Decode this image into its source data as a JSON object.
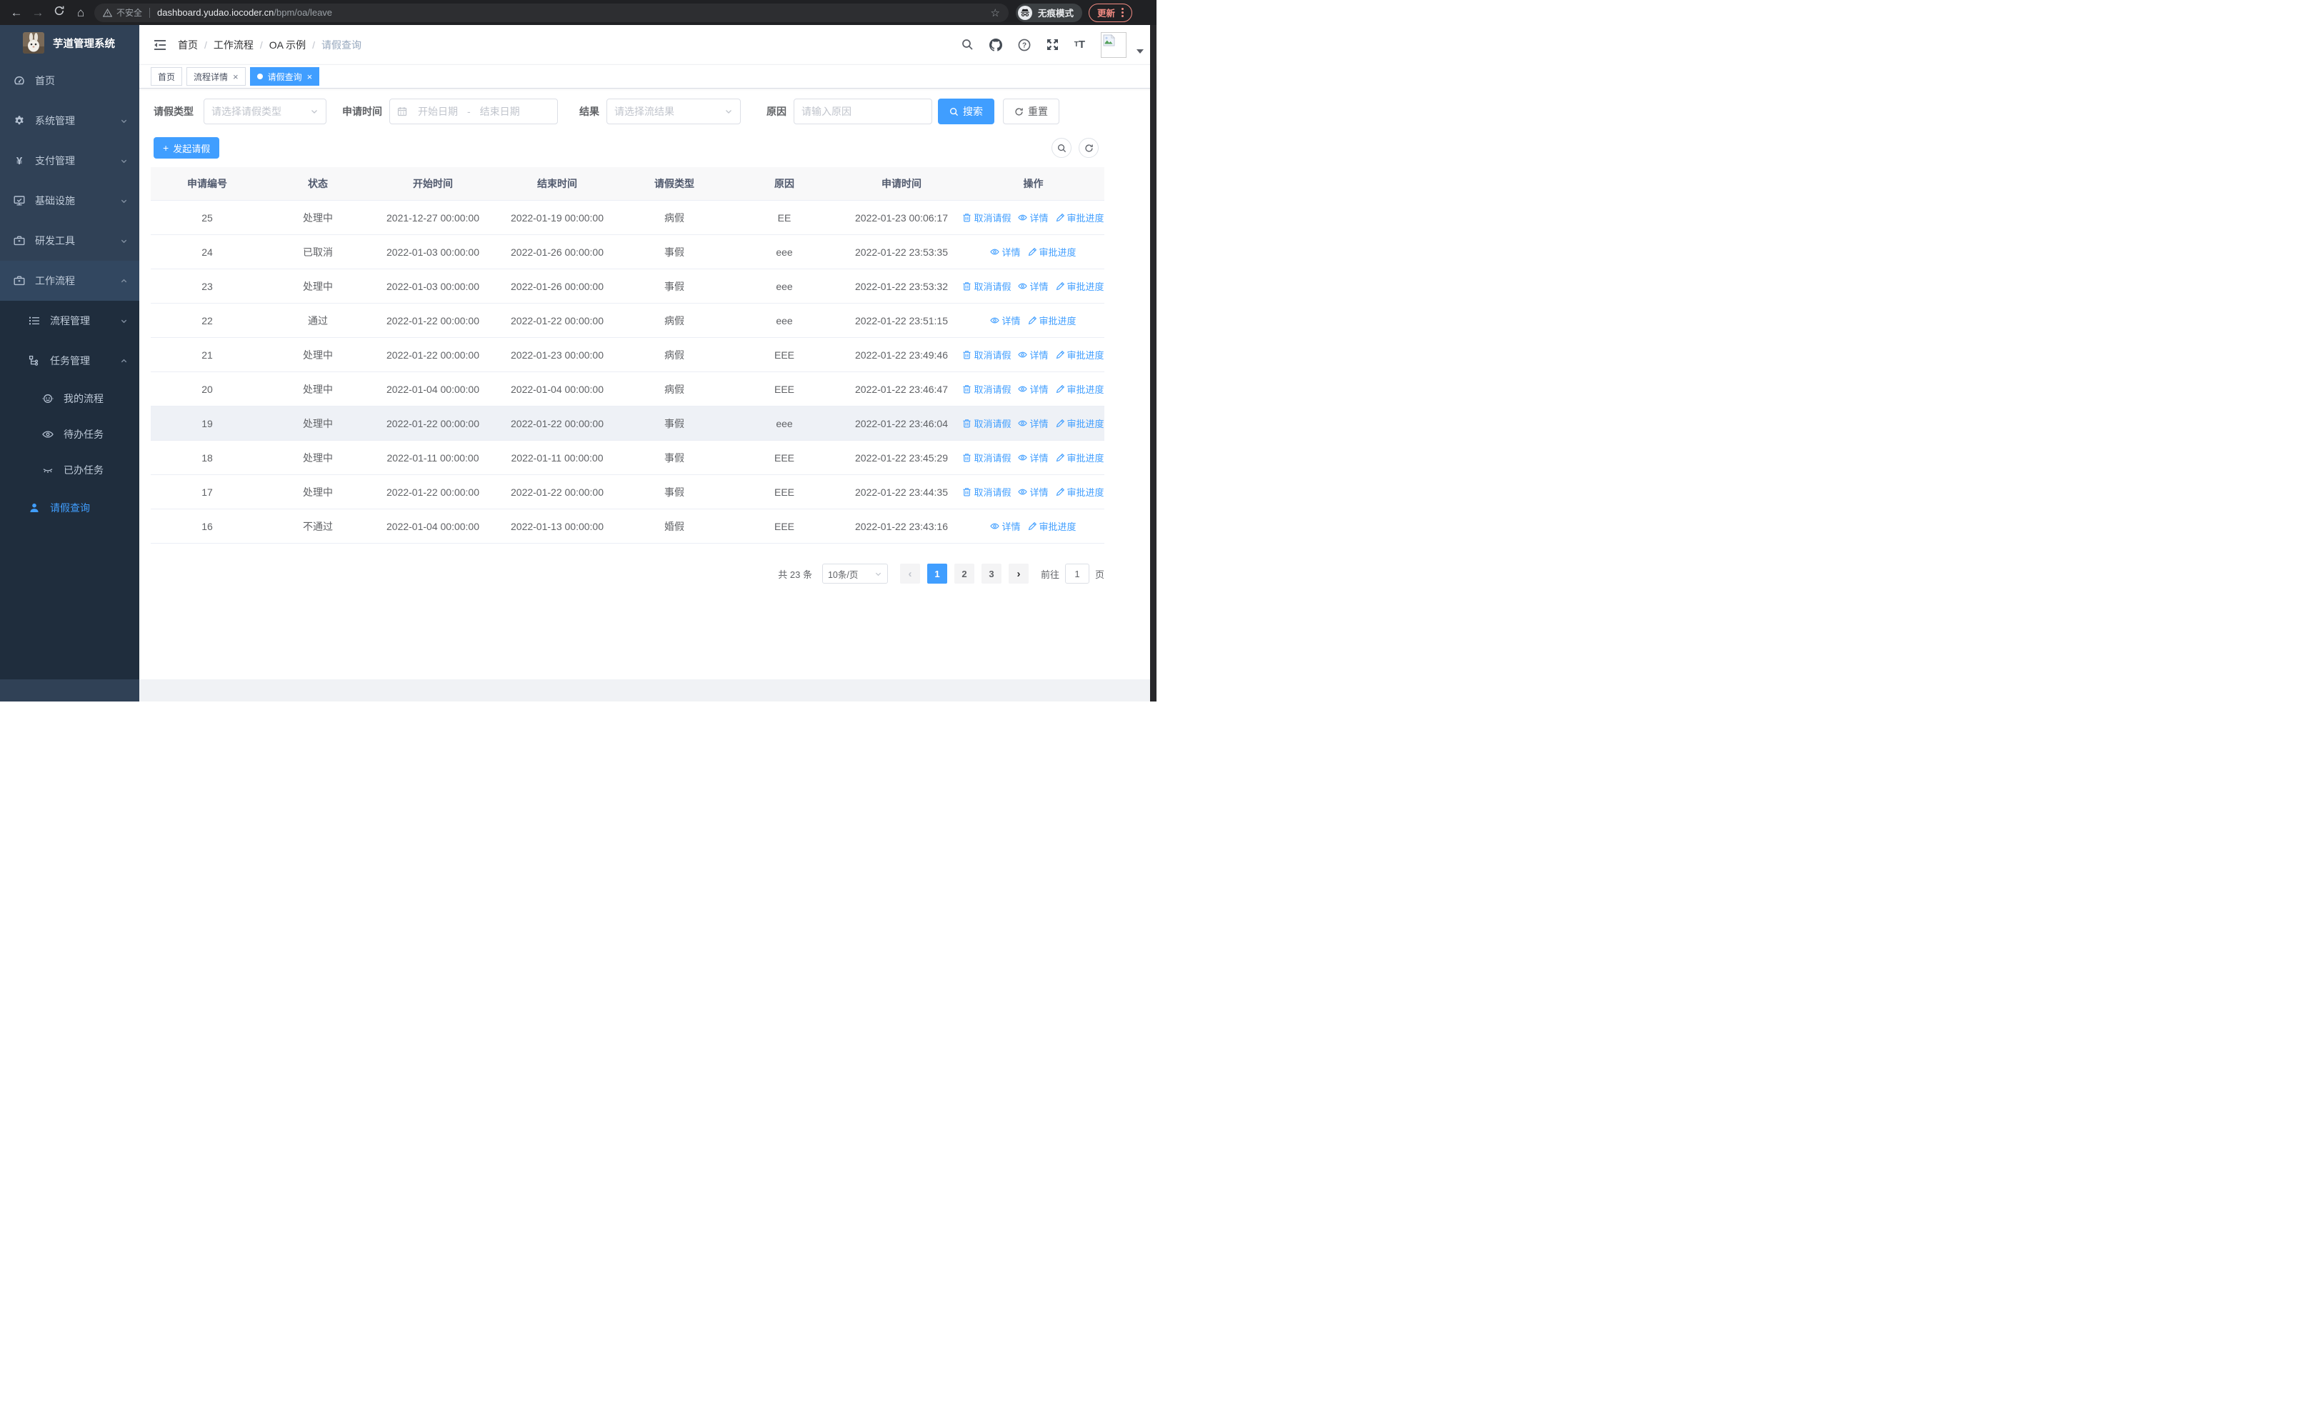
{
  "browser": {
    "security_label": "不安全",
    "url_host": "dashboard.yudao.iocoder.cn",
    "url_path": "/bpm/oa/leave",
    "incognito_label": "无痕模式",
    "update_label": "更新"
  },
  "sidebar": {
    "title": "芋道管理系统",
    "menu": [
      {
        "label": "首页",
        "icon": "dashboard-icon"
      },
      {
        "label": "系统管理",
        "icon": "gear-icon"
      },
      {
        "label": "支付管理",
        "icon": "yen-icon"
      },
      {
        "label": "基础设施",
        "icon": "monitor-icon"
      },
      {
        "label": "研发工具",
        "icon": "toolbox-icon"
      },
      {
        "label": "工作流程",
        "icon": "briefcase-icon"
      }
    ],
    "workflow_children": [
      {
        "label": "流程管理",
        "icon": "tree-table-icon"
      },
      {
        "label": "任务管理",
        "icon": "tree-icon"
      }
    ],
    "task_children": [
      {
        "label": "我的流程",
        "icon": "robot-icon"
      },
      {
        "label": "待办任务",
        "icon": "eye-open-icon"
      },
      {
        "label": "已办任务",
        "icon": "eye-closed-icon"
      }
    ],
    "leave_item": {
      "label": "请假查询",
      "icon": "user-icon"
    }
  },
  "header": {
    "breadcrumb": [
      "首页",
      "工作流程",
      "OA 示例",
      "请假查询"
    ]
  },
  "tabs": [
    {
      "label": "首页",
      "closable": false,
      "active": false
    },
    {
      "label": "流程详情",
      "closable": true,
      "active": false
    },
    {
      "label": "请假查询",
      "closable": true,
      "active": true
    }
  ],
  "filters": {
    "leave_type_label": "请假类型",
    "leave_type_placeholder": "请选择请假类型",
    "apply_time_label": "申请时间",
    "date_start_placeholder": "开始日期",
    "date_separator": "-",
    "date_end_placeholder": "结束日期",
    "result_label": "结果",
    "result_placeholder": "请选择流结果",
    "reason_label": "原因",
    "reason_placeholder": "请输入原因",
    "search_label": "搜索",
    "reset_label": "重置"
  },
  "toolbar": {
    "create_label": "发起请假"
  },
  "table": {
    "headers": [
      "申请编号",
      "状态",
      "开始时间",
      "结束时间",
      "请假类型",
      "原因",
      "申请时间",
      "操作"
    ],
    "rows": [
      {
        "id": "25",
        "status": "处理中",
        "start": "2021-12-27 00:00:00",
        "end": "2022-01-19 00:00:00",
        "type": "病假",
        "reason": "EE",
        "applied": "2022-01-23 00:06:17",
        "hovered": false,
        "ops": [
          {
            "label": "取消请假",
            "icon": "trash-icon"
          },
          {
            "label": "详情",
            "icon": "view-icon"
          },
          {
            "label": "审批进度",
            "icon": "edit-icon"
          }
        ]
      },
      {
        "id": "24",
        "status": "已取消",
        "start": "2022-01-03 00:00:00",
        "end": "2022-01-26 00:00:00",
        "type": "事假",
        "reason": "eee",
        "applied": "2022-01-22 23:53:35",
        "hovered": false,
        "ops": [
          {
            "label": "详情",
            "icon": "view-icon"
          },
          {
            "label": "审批进度",
            "icon": "edit-icon"
          }
        ]
      },
      {
        "id": "23",
        "status": "处理中",
        "start": "2022-01-03 00:00:00",
        "end": "2022-01-26 00:00:00",
        "type": "事假",
        "reason": "eee",
        "applied": "2022-01-22 23:53:32",
        "hovered": false,
        "ops": [
          {
            "label": "取消请假",
            "icon": "trash-icon"
          },
          {
            "label": "详情",
            "icon": "view-icon"
          },
          {
            "label": "审批进度",
            "icon": "edit-icon"
          }
        ]
      },
      {
        "id": "22",
        "status": "通过",
        "start": "2022-01-22 00:00:00",
        "end": "2022-01-22 00:00:00",
        "type": "病假",
        "reason": "eee",
        "applied": "2022-01-22 23:51:15",
        "hovered": false,
        "ops": [
          {
            "label": "详情",
            "icon": "view-icon"
          },
          {
            "label": "审批进度",
            "icon": "edit-icon"
          }
        ]
      },
      {
        "id": "21",
        "status": "处理中",
        "start": "2022-01-22 00:00:00",
        "end": "2022-01-23 00:00:00",
        "type": "病假",
        "reason": "EEE",
        "applied": "2022-01-22 23:49:46",
        "hovered": false,
        "ops": [
          {
            "label": "取消请假",
            "icon": "trash-icon"
          },
          {
            "label": "详情",
            "icon": "view-icon"
          },
          {
            "label": "审批进度",
            "icon": "edit-icon"
          }
        ]
      },
      {
        "id": "20",
        "status": "处理中",
        "start": "2022-01-04 00:00:00",
        "end": "2022-01-04 00:00:00",
        "type": "病假",
        "reason": "EEE",
        "applied": "2022-01-22 23:46:47",
        "hovered": false,
        "ops": [
          {
            "label": "取消请假",
            "icon": "trash-icon"
          },
          {
            "label": "详情",
            "icon": "view-icon"
          },
          {
            "label": "审批进度",
            "icon": "edit-icon"
          }
        ]
      },
      {
        "id": "19",
        "status": "处理中",
        "start": "2022-01-22 00:00:00",
        "end": "2022-01-22 00:00:00",
        "type": "事假",
        "reason": "eee",
        "applied": "2022-01-22 23:46:04",
        "hovered": true,
        "ops": [
          {
            "label": "取消请假",
            "icon": "trash-icon"
          },
          {
            "label": "详情",
            "icon": "view-icon"
          },
          {
            "label": "审批进度",
            "icon": "edit-icon"
          }
        ]
      },
      {
        "id": "18",
        "status": "处理中",
        "start": "2022-01-11 00:00:00",
        "end": "2022-01-11 00:00:00",
        "type": "事假",
        "reason": "EEE",
        "applied": "2022-01-22 23:45:29",
        "hovered": false,
        "ops": [
          {
            "label": "取消请假",
            "icon": "trash-icon"
          },
          {
            "label": "详情",
            "icon": "view-icon"
          },
          {
            "label": "审批进度",
            "icon": "edit-icon"
          }
        ]
      },
      {
        "id": "17",
        "status": "处理中",
        "start": "2022-01-22 00:00:00",
        "end": "2022-01-22 00:00:00",
        "type": "事假",
        "reason": "EEE",
        "applied": "2022-01-22 23:44:35",
        "hovered": false,
        "ops": [
          {
            "label": "取消请假",
            "icon": "trash-icon"
          },
          {
            "label": "详情",
            "icon": "view-icon"
          },
          {
            "label": "审批进度",
            "icon": "edit-icon"
          }
        ]
      },
      {
        "id": "16",
        "status": "不通过",
        "start": "2022-01-04 00:00:00",
        "end": "2022-01-13 00:00:00",
        "type": "婚假",
        "reason": "EEE",
        "applied": "2022-01-22 23:43:16",
        "hovered": false,
        "ops": [
          {
            "label": "详情",
            "icon": "view-icon"
          },
          {
            "label": "审批进度",
            "icon": "edit-icon"
          }
        ]
      }
    ]
  },
  "pagination": {
    "total": "共 23 条",
    "page_size": "10条/页",
    "pages": [
      "1",
      "2",
      "3"
    ],
    "active_page": "1",
    "goto_label": "前往",
    "goto_value": "1",
    "goto_suffix": "页"
  },
  "colors": {
    "primary": "#409eff",
    "sidebar": "#304156",
    "sidebar_sub": "#1f2d3d"
  }
}
